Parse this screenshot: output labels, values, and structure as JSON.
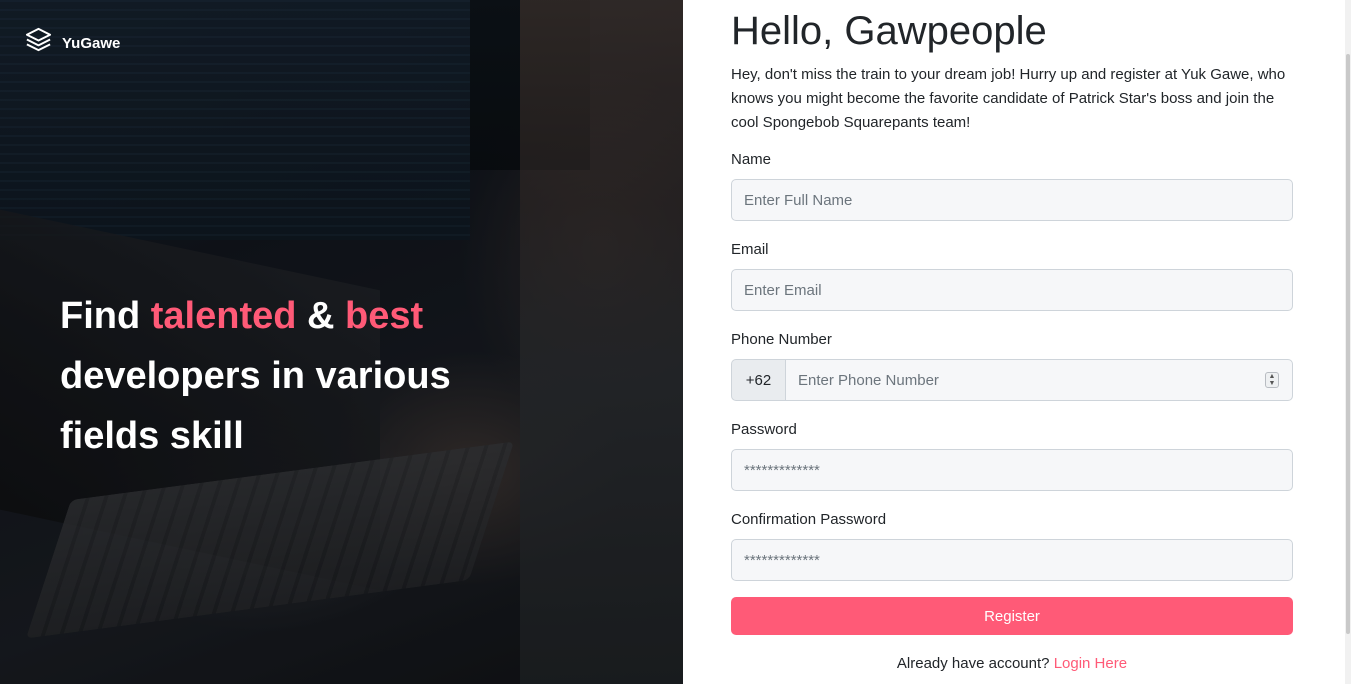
{
  "brand": {
    "name": "YuGawe",
    "icon": "layers-icon"
  },
  "hero": {
    "line1_a": "Find ",
    "line1_b": "talented",
    "line1_c": " & ",
    "line1_d": "best",
    "line2": "developers in various",
    "line3": "fields skill",
    "accent_color": "#ff5a77"
  },
  "form": {
    "title": "Hello, Gawpeople",
    "intro": "Hey, don't miss the train to your dream job! Hurry up and register at Yuk Gawe, who knows you might become the favorite candidate of Patrick Star's boss and join the cool Spongebob Squarepants team!",
    "name": {
      "label": "Name",
      "placeholder": "Enter Full Name"
    },
    "email": {
      "label": "Email",
      "placeholder": "Enter Email"
    },
    "phone": {
      "label": "Phone Number",
      "prefix": "+62",
      "placeholder": "Enter Phone Number"
    },
    "password": {
      "label": "Password",
      "placeholder": "*************"
    },
    "confirm_password": {
      "label": "Confirmation Password",
      "placeholder": "*************"
    },
    "register_label": "Register",
    "login_prompt": "Already have account? ",
    "login_link": "Login Here",
    "button_color": "#ff5a77"
  }
}
